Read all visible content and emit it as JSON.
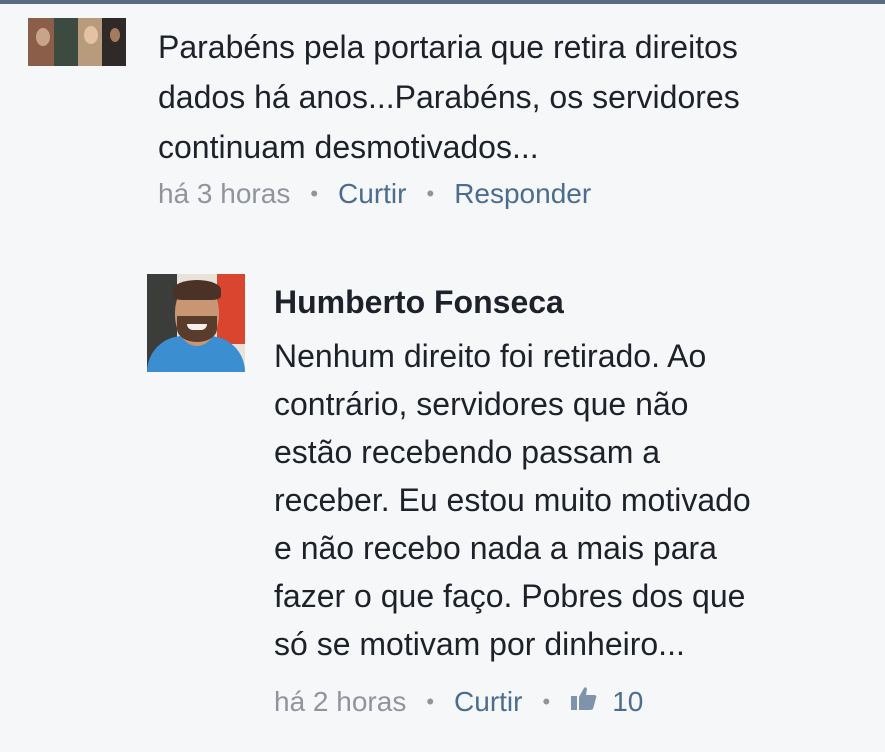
{
  "comment1": {
    "text_lines": [
      "Parabéns pela portaria que retira direitos",
      "dados há anos...Parabéns, os servidores",
      "continuam desmotivados..."
    ],
    "time": "há 3 horas",
    "like_label": "Curtir",
    "reply_label": "Responder"
  },
  "comment2": {
    "author": "Humberto Fonseca",
    "text_lines": [
      "Nenhum direito foi retirado. Ao",
      "contrário, servidores que não",
      "estão recebendo passam a",
      "receber. Eu estou muito motivado",
      "e não recebo nada a mais para",
      "fazer o que faço. Pobres dos que",
      "só se motivam por dinheiro..."
    ],
    "time": "há 2 horas",
    "like_label": "Curtir",
    "like_count": "10"
  },
  "separator": "•",
  "colors": {
    "text": "#1d2129",
    "meta": "#90949c",
    "link": "#4b6d8f",
    "like_icon": "#7f93ad"
  }
}
